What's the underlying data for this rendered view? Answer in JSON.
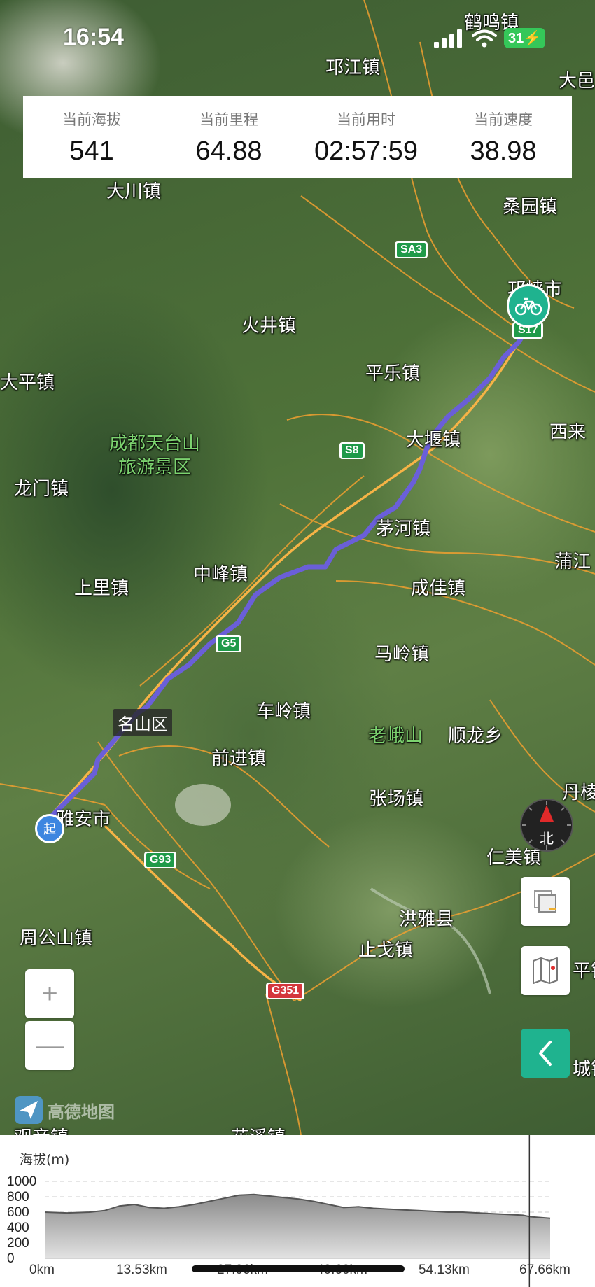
{
  "status_bar": {
    "time": "16:54",
    "battery": "31"
  },
  "stats": [
    {
      "label": "当前海拔",
      "value": "541"
    },
    {
      "label": "当前里程",
      "value": "64.88"
    },
    {
      "label": "当前用时",
      "value": "02:57:59"
    },
    {
      "label": "当前速度",
      "value": "38.98"
    }
  ],
  "map": {
    "places": {
      "hemingzhen": "鹤鸣镇",
      "qiongjiangzhen": "邛江镇",
      "dayi": "大邑",
      "dachuanzhen": "大川镇",
      "sangyuanzhen": "桑园镇",
      "qionglaishi": "邛崃市",
      "huojingzhen": "火井镇",
      "pingle": "平乐镇",
      "dapingzhen": "大平镇",
      "tiantai": "成都天台山\n旅游景区",
      "dadangzhen": "大堰镇",
      "xilai": "西来",
      "longmen": "龙门镇",
      "maohe": "茅河镇",
      "pujiang": "蒲江",
      "shangli": "上里镇",
      "zhongfeng": "中峰镇",
      "chengjia": "成佳镇",
      "maling": "马岭镇",
      "mingshanqu": "名山区",
      "cheling": "车岭镇",
      "laoeshan": "老峨山",
      "shunlong": "顺龙乡",
      "qianjin": "前进镇",
      "zhangchang": "张场镇",
      "danleng": "丹棱",
      "yaanshi": "雅安市",
      "renmei": "仁美镇",
      "hongya": "洪雅县",
      "zhougongshan": "周公山镇",
      "zhangge": "止戈镇",
      "ping": "平镇",
      "cheng": "城镇",
      "huaxi": "花溪镇",
      "guan": "观音镇"
    },
    "shields": {
      "sa3": "SA3",
      "s8": "S8",
      "s7": "S17",
      "g5": "G5",
      "g93": "G93",
      "g351": "G351"
    },
    "start_marker": "起",
    "compass_label": "北",
    "zoom_in": "+",
    "zoom_out": "—",
    "logo_text": "高德地图"
  },
  "elevation": {
    "title": "海拔(m)",
    "y_ticks": [
      "1000",
      "800",
      "600",
      "400",
      "200",
      "0"
    ],
    "x_ticks": [
      "0km",
      "13.53km",
      "27.06km",
      "40.60km",
      "54.13km",
      "67.66km"
    ],
    "current_km": 64.88,
    "chart_data": {
      "type": "area",
      "ylabel": "海拔(m)",
      "ylim": [
        0,
        1000
      ],
      "xlim": [
        0,
        67.66
      ],
      "x": [
        0,
        3,
        6,
        8,
        10,
        12,
        14,
        16,
        18,
        20,
        22,
        24,
        26,
        28,
        30,
        32,
        34,
        36,
        38,
        40,
        42,
        44,
        46,
        48,
        50,
        52,
        54,
        56,
        58,
        60,
        62,
        64,
        65,
        67.66
      ],
      "y": [
        600,
        590,
        600,
        620,
        680,
        700,
        660,
        650,
        670,
        700,
        740,
        780,
        820,
        830,
        810,
        790,
        770,
        740,
        700,
        660,
        670,
        650,
        640,
        630,
        620,
        610,
        600,
        600,
        590,
        580,
        570,
        560,
        541,
        520
      ]
    }
  },
  "colors": {
    "route": "#6a5fd8",
    "accent_green": "#1fb38f",
    "road": "#f0a030",
    "stat_value": "#111111"
  }
}
